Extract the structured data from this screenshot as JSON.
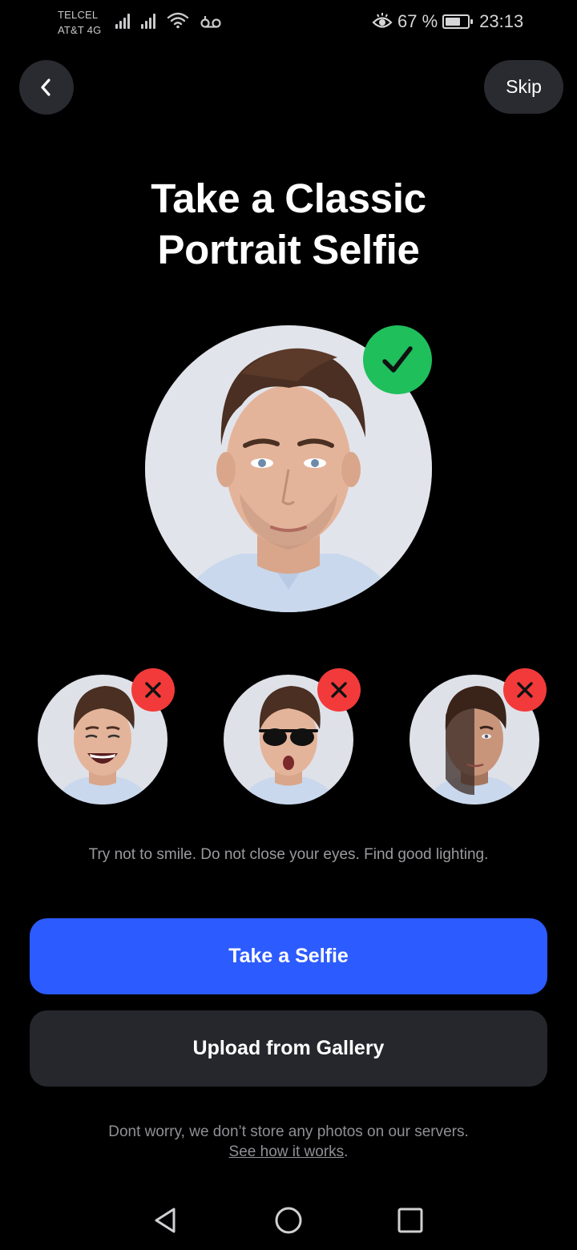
{
  "status_bar": {
    "carrier_1": "TELCEL",
    "carrier_2": "AT&T 4G",
    "battery_percent": "67 %",
    "battery_level": 0.67,
    "time": "23:13",
    "icons": [
      "signal-icon",
      "signal-icon",
      "wifi-icon",
      "voicemail-icon",
      "eye-comfort-icon",
      "battery-icon"
    ]
  },
  "header": {
    "back_icon": "chevron-left-icon",
    "skip_label": "Skip"
  },
  "title": {
    "line_1": "Take a Classic",
    "line_2": "Portrait Selfie"
  },
  "examples": {
    "good_badge_icon": "check-icon",
    "bad_badge_icon": "x-icon",
    "good_color": "#1fbf5c",
    "bad_color": "#f23a3a"
  },
  "hint": "Try not to smile. Do not close your eyes. Find good lighting.",
  "actions": {
    "primary_label": "Take a Selfie",
    "primary_color": "#2c5bff",
    "secondary_label": "Upload from Gallery"
  },
  "disclaimer": {
    "text": "Dont worry, we don’t store any photos on our servers.",
    "link": "See how it works",
    "link_suffix": "."
  },
  "nav_bar": {
    "icons": [
      "back-triangle-icon",
      "home-circle-icon",
      "recents-square-icon"
    ]
  }
}
